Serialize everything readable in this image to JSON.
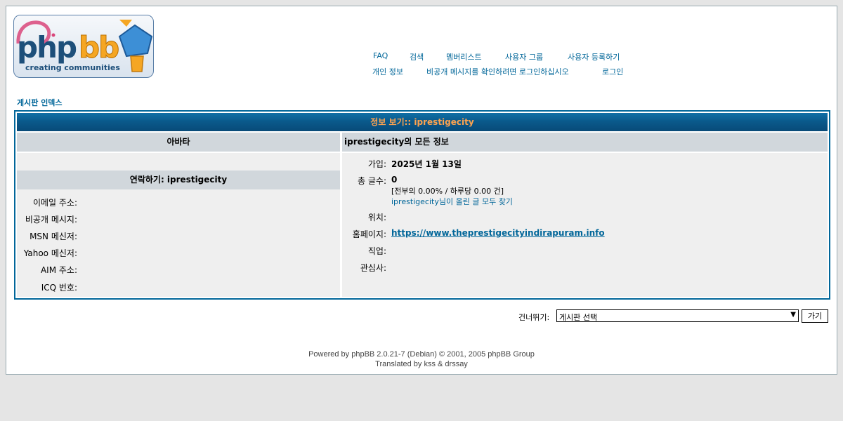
{
  "logo": {
    "text": "phpbb",
    "tagline": "creating communities"
  },
  "nav": {
    "row1": [
      "FAQ",
      "검색",
      "멤버리스트",
      "사용자 그룹",
      "사용자 등록하기"
    ],
    "row2": [
      "개인 정보",
      "비공개 메시지를 확인하려면 로그인하십시오",
      "로그인"
    ]
  },
  "breadcrumb": "게시판 인덱스",
  "profile": {
    "title": "정보 보기:: iprestigecity",
    "avatar_header": "아바타",
    "all_info_header": "iprestigecity의 모든 정보",
    "contact_header": "연락하기: iprestigecity",
    "contact_fields": [
      "이메일 주소:",
      "비공개 메시지:",
      "MSN 메신저:",
      "Yahoo 메신저:",
      "AIM 주소:",
      "ICQ 번호:"
    ],
    "joined_label": "가입:",
    "joined_value": "2025년 1월 13일",
    "posts_label": "총 글수:",
    "posts_value": "0",
    "posts_stats": "[전부의 0.00% / 하루당 0.00 건]",
    "posts_search": "iprestigecity님이 올린 글 모두 찾기",
    "location_label": "위치:",
    "website_label": "홈페이지:",
    "website_value": "https://www.theprestigecityindirapuram.info",
    "occupation_label": "직업:",
    "interests_label": "관심사:"
  },
  "jump": {
    "label": "건너뛰기:",
    "selected": "게시판 선택",
    "go": "가기"
  },
  "footer": {
    "line1": "Powered by phpBB 2.0.21-7 (Debian) © 2001, 2005 phpBB Group",
    "line2": "Translated by kss & drssay"
  }
}
